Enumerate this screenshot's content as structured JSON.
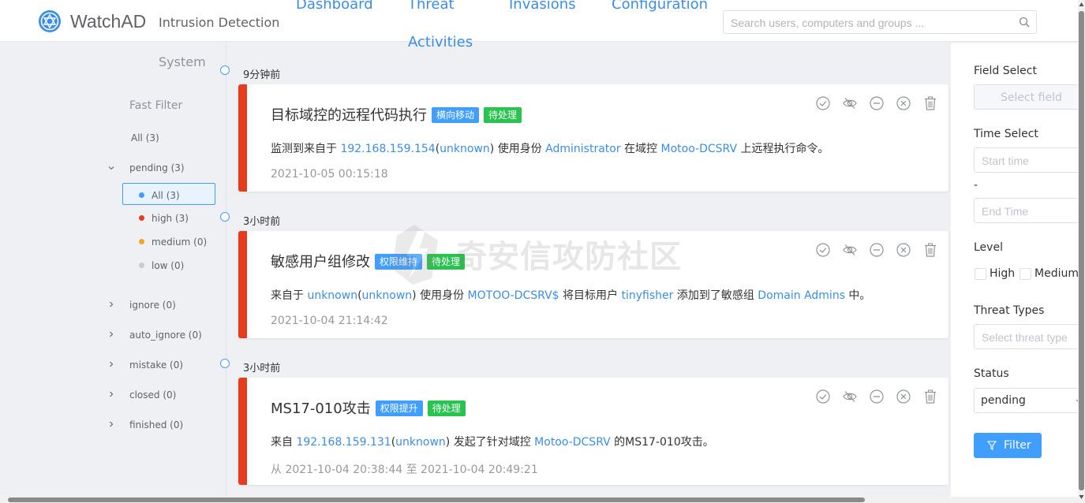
{
  "header": {
    "brand": "WatchAD",
    "subtitle": "Intrusion Detection",
    "nav": [
      {
        "label": "Dashboard"
      },
      {
        "label": "Threat"
      },
      {
        "label": "Activities"
      },
      {
        "label": "Invasions"
      },
      {
        "label": "Configuration"
      }
    ],
    "search_placeholder": "Search users, computers and groups ..."
  },
  "sidebar": {
    "system": "System",
    "fast_filter": "Fast Filter",
    "all": "All (3)",
    "pending": "pending (3)",
    "pending_children": [
      {
        "label": "All (3)",
        "color": "#409eff"
      },
      {
        "label": "high (3)",
        "color": "#e63c1e"
      },
      {
        "label": "medium (0)",
        "color": "#f5a623"
      },
      {
        "label": "low (0)",
        "color": "#c8cbd0"
      }
    ],
    "others": [
      {
        "label": "ignore (0)"
      },
      {
        "label": "auto_ignore (0)"
      },
      {
        "label": "mistake (0)"
      },
      {
        "label": "closed (0)"
      },
      {
        "label": "finished (0)"
      }
    ]
  },
  "alerts": [
    {
      "relative_time": "9分钟前",
      "title": "目标域控的远程代码执行",
      "tags": [
        {
          "label": "横向移动",
          "color": "blue"
        },
        {
          "label": "待处理",
          "color": "green"
        }
      ],
      "desc": {
        "p1": "监测到来自于 ",
        "ip": "192.168.159.154",
        "po": "(",
        "host": "unknown",
        "pc": ")",
        "p2": " 使用身份 ",
        "user": "Administrator",
        "p3": " 在域控 ",
        "dc": "Motoo-DCSRV",
        "p4": " 上远程执行命令。"
      },
      "time": "2021-10-05 00:15:18"
    },
    {
      "relative_time": "3小时前",
      "title": "敏感用户组修改",
      "tags": [
        {
          "label": "权限维持",
          "color": "blue"
        },
        {
          "label": "待处理",
          "color": "green"
        }
      ],
      "desc": {
        "p1": "来自于 ",
        "host": "unknown",
        "po": "(",
        "host2": "unknown",
        "pc": ")",
        "p2": " 使用身份 ",
        "user": "MOTOO-DCSRV$",
        "p3": " 将目标用户 ",
        "target": "tinyfisher",
        "p4": " 添加到了敏感组 ",
        "group": "Domain Admins",
        "p5": " 中。"
      },
      "time": "2021-10-04 21:14:42"
    },
    {
      "relative_time": "3小时前",
      "title": "MS17-010攻击",
      "tags": [
        {
          "label": "权限提升",
          "color": "blue"
        },
        {
          "label": "待处理",
          "color": "green"
        }
      ],
      "desc": {
        "p1": "来自 ",
        "ip": "192.168.159.131",
        "po": "(",
        "host": "unknown",
        "pc": ")",
        "p2": " 发起了针对域控 ",
        "dc": "Motoo-DCSRV",
        "p3": " 的MS17-010攻击。"
      },
      "time": "从 2021-10-04 20:38:44 至 2021-10-04 20:49:21"
    }
  ],
  "watermark": "奇安信攻防社区",
  "filter_panel": {
    "field_select_label": "Field Select",
    "field_select_placeholder": "Select field",
    "time_select_label": "Time Select",
    "start_placeholder": "Start time",
    "dash": "-",
    "end_placeholder": "End Time",
    "level_label": "Level",
    "level_high": "High",
    "level_medium": "Medium",
    "threat_types_label": "Threat Types",
    "threat_types_placeholder": "Select threat type",
    "status_label": "Status",
    "status_value": "pending",
    "filter_button": "Filter"
  },
  "colors": {
    "accent": "#409eff",
    "link": "#3a8ee6",
    "alert_bar": "#e63c1e",
    "tag_blue": "#409eff",
    "tag_green": "#29c34f"
  }
}
